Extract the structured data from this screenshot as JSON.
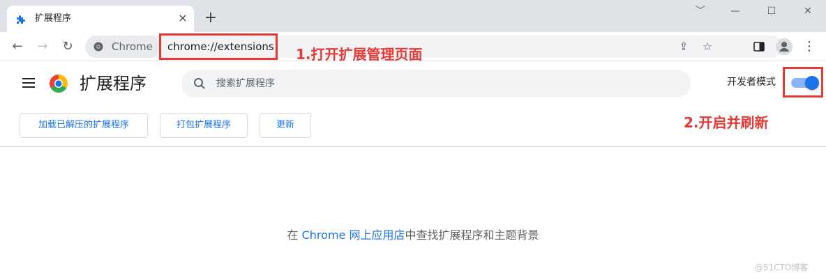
{
  "tab": {
    "title": "扩展程序",
    "close": "×",
    "icon": "puzzle-icon"
  },
  "new_tab": "+",
  "window_controls": {
    "minimize": "—",
    "maximize": "☐",
    "close": "✕",
    "dropdown": "﹀"
  },
  "toolbar": {
    "back": "←",
    "forward": "→",
    "reload": "↻",
    "chip_label": "Chrome",
    "url": "chrome://extensions"
  },
  "annotations": {
    "step1": "1.打开扩展管理页面",
    "step2": "2.开启并刷新"
  },
  "extensions_page": {
    "title": "扩展程序",
    "search_placeholder": "搜索扩展程序",
    "dev_mode_label": "开发者模式",
    "dev_mode_enabled": true,
    "buttons": [
      "加载已解压的扩展程序",
      "打包扩展程序",
      "更新"
    ],
    "empty_prefix": "在 ",
    "empty_link": "Chrome 网上应用店",
    "empty_suffix": "中查找扩展程序和主题背景"
  },
  "watermark": "@51CTO博客",
  "colors": {
    "accent": "#1a73e8",
    "annotation": "#e53935",
    "tabstrip": "#dee1e6"
  }
}
